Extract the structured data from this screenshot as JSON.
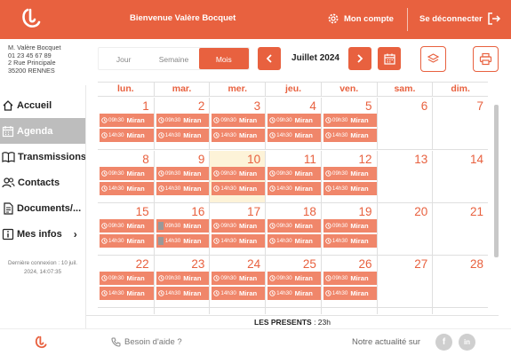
{
  "header": {
    "welcome": "Bienvenue Valère Bocquet",
    "account_label": "Mon compte",
    "logout_label": "Se déconnecter",
    "accent_color": "#e8613f"
  },
  "user": {
    "name": "M. Valère Bocquet",
    "phone": "01 23 45 67 89",
    "address1": "2 Rue Principale",
    "address2": "35200 RENNES"
  },
  "nav": {
    "items": [
      {
        "label": "Accueil",
        "icon": "home-icon"
      },
      {
        "label": "Agenda",
        "icon": "calendar-icon",
        "active": true
      },
      {
        "label": "Transmissions",
        "icon": "book-icon"
      },
      {
        "label": "Contacts",
        "icon": "contacts-icon"
      },
      {
        "label": "Documents/...",
        "icon": "document-icon"
      },
      {
        "label": "Mes infos",
        "icon": "info-icon"
      }
    ],
    "last_connection_1": "Dernière connexion : 10 juil.",
    "last_connection_2": "2024, 14:07:35"
  },
  "toolbar": {
    "views": [
      "Jour",
      "Semaine",
      "Mois"
    ],
    "active_view": "Mois",
    "month": "Juillet 2024"
  },
  "calendar": {
    "days_of_week": [
      "lun.",
      "mar.",
      "mer.",
      "jeu.",
      "ven.",
      "sam.",
      "dim."
    ],
    "today": 10,
    "weeks": [
      [
        1,
        2,
        3,
        4,
        5,
        6,
        7
      ],
      [
        8,
        9,
        10,
        11,
        12,
        13,
        14
      ],
      [
        15,
        16,
        17,
        18,
        19,
        20,
        21
      ],
      [
        22,
        23,
        24,
        25,
        26,
        27,
        28
      ]
    ],
    "event_times": [
      "09h30",
      "14h30"
    ],
    "event_title": "Miran",
    "event_days": [
      1,
      2,
      3,
      4,
      5,
      8,
      9,
      10,
      11,
      12,
      15,
      16,
      17,
      18,
      19,
      22,
      23,
      24,
      25,
      26
    ],
    "no_clock_days": [
      16
    ]
  },
  "presents": {
    "label": "LES PRESENTS",
    "value": " : 23h"
  },
  "footer": {
    "help": "Besoin d'aide ?",
    "news": "Notre actualité sur"
  }
}
